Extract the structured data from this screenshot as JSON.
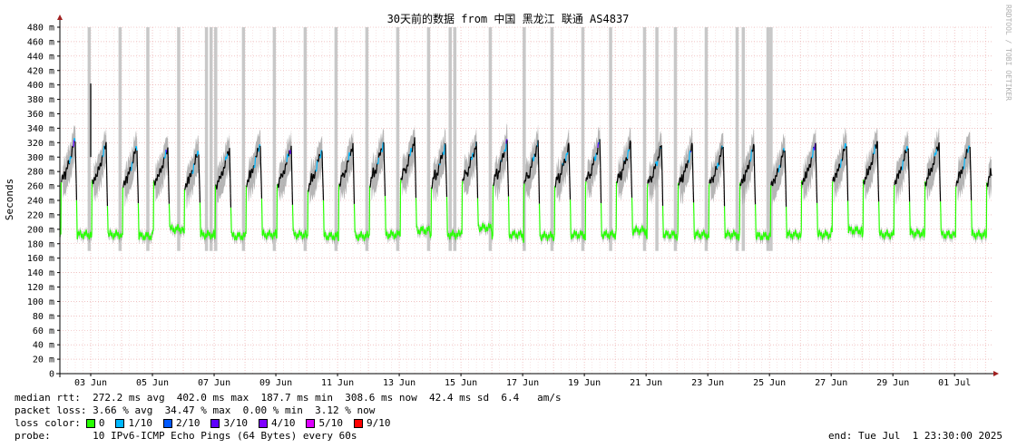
{
  "chart_data": {
    "type": "line",
    "title": "30天前的数据 from 中国 黑龙江 联通 AS4837",
    "ylabel": "Seconds",
    "ylim": [
      0,
      0.48
    ],
    "yticks": [
      "0",
      "20 m",
      "40 m",
      "60 m",
      "80 m",
      "100 m",
      "120 m",
      "140 m",
      "160 m",
      "180 m",
      "200 m",
      "220 m",
      "240 m",
      "260 m",
      "280 m",
      "300 m",
      "320 m",
      "340 m",
      "360 m",
      "380 m",
      "400 m",
      "420 m",
      "440 m",
      "460 m",
      "480 m"
    ],
    "xticks": [
      "03 Jun",
      "05 Jun",
      "07 Jun",
      "09 Jun",
      "11 Jun",
      "13 Jun",
      "15 Jun",
      "17 Jun",
      "19 Jun",
      "21 Jun",
      "23 Jun",
      "25 Jun",
      "27 Jun",
      "29 Jun",
      "01 Jul"
    ],
    "xrange_days": [
      0,
      30.2
    ],
    "grid": true,
    "daily_min_ms": [
      190,
      190,
      188,
      198,
      190,
      188,
      190,
      190,
      188,
      188,
      190,
      196,
      190,
      200,
      190,
      188,
      190,
      190,
      196,
      190,
      190,
      190,
      188,
      190,
      190,
      196,
      190,
      192,
      190,
      190
    ],
    "daily_max_ms": [
      325,
      318,
      315,
      312,
      310,
      312,
      320,
      315,
      312,
      318,
      322,
      325,
      318,
      318,
      322,
      320,
      315,
      322,
      318,
      315,
      315,
      315,
      315,
      312,
      318,
      320,
      322,
      318,
      320,
      320
    ],
    "loss_spikes_day": [
      0.9,
      1.9,
      2.8,
      3.8,
      4.7,
      4.85,
      5.0,
      5.9,
      6.9,
      7.9,
      8.9,
      9.9,
      10.9,
      11.9,
      12.6,
      12.75,
      13.9,
      15.0,
      15.9,
      16.9,
      17.8,
      18.9,
      19.3,
      19.9,
      20.9,
      21.9,
      22.1,
      22.9,
      23.0
    ],
    "peak_spike": {
      "day": 1.0,
      "value_ms": 402
    },
    "watermark": "RRDTOOL / TOBI OETIKER"
  },
  "stats": {
    "median_rtt": "median rtt:  272.2 ms avg  402.0 ms max  187.7 ms min  308.6 ms now  42.4 ms sd  6.4   am/s",
    "packet_loss": "packet loss: 3.66 % avg  34.47 % max  0.00 % min  3.12 % now",
    "loss_color_label": "loss color:",
    "loss_colors": [
      {
        "label": "0",
        "color": "#26ff00"
      },
      {
        "label": "1/10",
        "color": "#00b8ff"
      },
      {
        "label": "2/10",
        "color": "#0059ff"
      },
      {
        "label": "3/10",
        "color": "#5e00ff"
      },
      {
        "label": "4/10",
        "color": "#7e00ff"
      },
      {
        "label": "5/10",
        "color": "#dd00ff"
      },
      {
        "label": "9/10",
        "color": "#ff0000"
      }
    ],
    "probe": "probe:       10 IPv6-ICMP Echo Pings (64 Bytes) every 60s",
    "end": "end: Tue Jul  1 23:30:00 2025"
  }
}
